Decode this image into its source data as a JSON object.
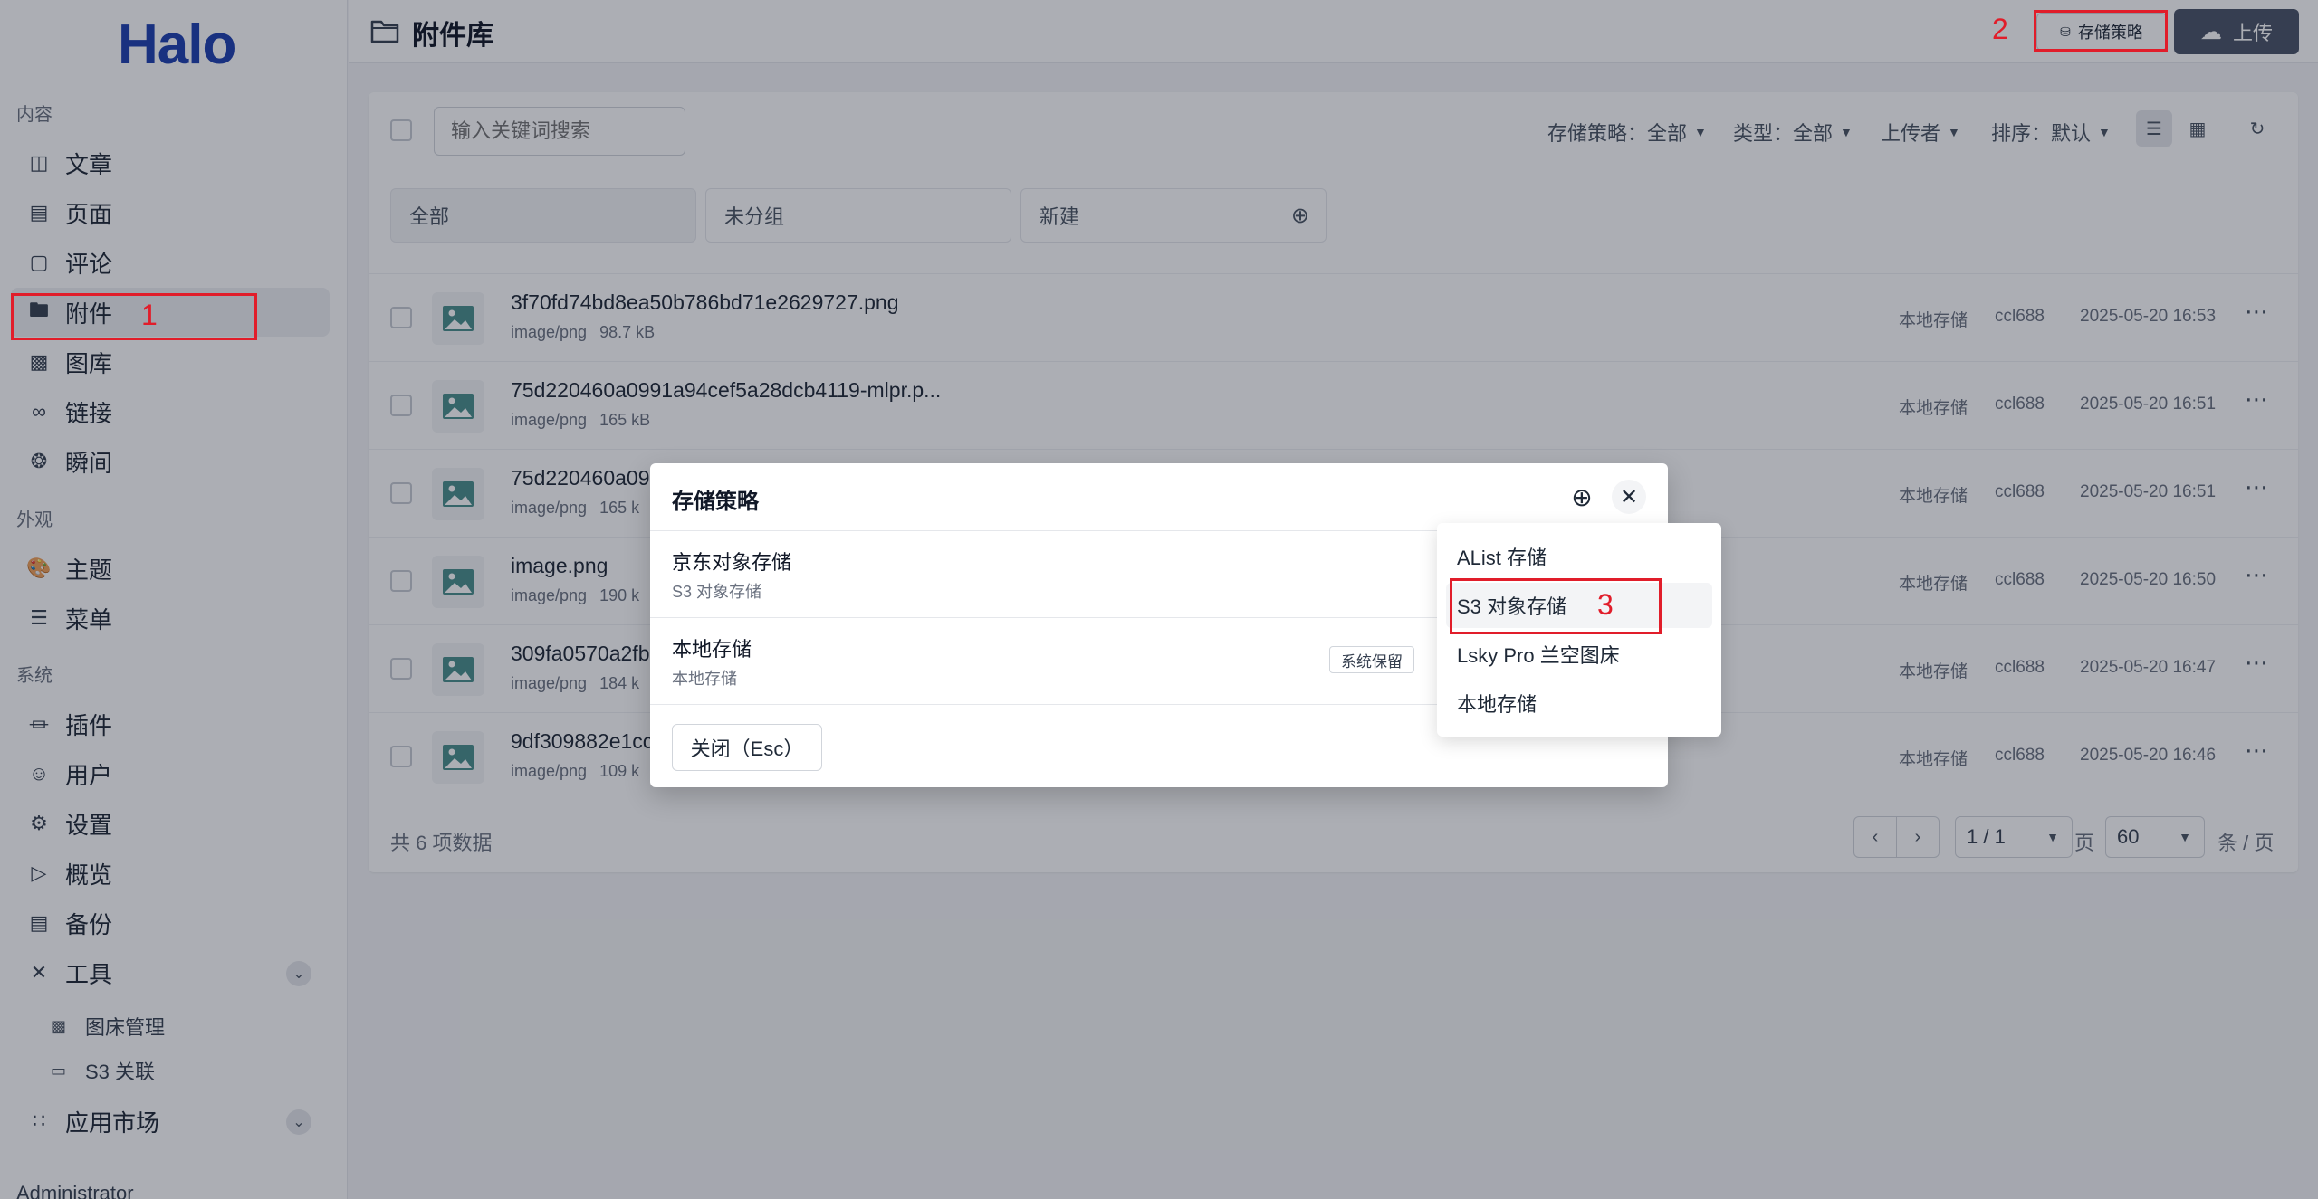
{
  "brand": {
    "logo": "Halo"
  },
  "sidebar": {
    "sections": {
      "content": "内容",
      "appearance": "外观",
      "system": "系统"
    },
    "items": [
      {
        "label": "文章",
        "icon": "book-open-icon"
      },
      {
        "label": "页面",
        "icon": "file-text-icon"
      },
      {
        "label": "评论",
        "icon": "message-icon"
      },
      {
        "label": "附件",
        "icon": "folder-icon"
      },
      {
        "label": "图库",
        "icon": "image-icon"
      },
      {
        "label": "链接",
        "icon": "link-icon"
      },
      {
        "label": "瞬间",
        "icon": "aperture-icon"
      },
      {
        "label": "主题",
        "icon": "palette-icon"
      },
      {
        "label": "菜单",
        "icon": "menu-settings-icon"
      },
      {
        "label": "插件",
        "icon": "plug-icon"
      },
      {
        "label": "用户",
        "icon": "user-icon"
      },
      {
        "label": "设置",
        "icon": "gear-icon"
      },
      {
        "label": "概览",
        "icon": "terminal-icon"
      },
      {
        "label": "备份",
        "icon": "archive-icon"
      },
      {
        "label": "工具",
        "icon": "tools-icon"
      },
      {
        "label": "应用市场",
        "icon": "grid-apps-icon"
      }
    ],
    "tool_subitems": [
      {
        "label": "图床管理",
        "icon": "image-manage-icon"
      },
      {
        "label": "S3 关联",
        "icon": "s3-link-icon"
      }
    ],
    "user": "Administrator"
  },
  "header": {
    "title": "附件库",
    "policies_button": "存储策略",
    "upload_button": "上传"
  },
  "toolbar": {
    "search_placeholder": "输入关键词搜索",
    "filter_policy": "存储策略：全部",
    "filter_type": "类型：全部",
    "filter_uploader": "上传者",
    "filter_sort": "排序：默认"
  },
  "groups": {
    "all": "全部",
    "ungrouped": "未分组",
    "new": "新建"
  },
  "files": [
    {
      "name": "3f70fd74bd8ea50b786bd71e2629727.png",
      "type": "image/png",
      "size": "98.7 kB",
      "policy": "本地存储",
      "user": "ccl688",
      "time": "2025-05-20 16:53"
    },
    {
      "name": "75d220460a0991a94cef5a28dcb4119-mlpr.p...",
      "type": "image/png",
      "size": "165 kB",
      "policy": "本地存储",
      "user": "ccl688",
      "time": "2025-05-20 16:51"
    },
    {
      "name": "75d220460a09",
      "type": "image/png",
      "size": "165 k",
      "policy": "本地存储",
      "user": "ccl688",
      "time": "2025-05-20 16:51"
    },
    {
      "name": "image.png",
      "type": "image/png",
      "size": "190 k",
      "policy": "本地存储",
      "user": "ccl688",
      "time": "2025-05-20 16:50"
    },
    {
      "name": "309fa0570a2fb",
      "type": "image/png",
      "size": "184 k",
      "policy": "本地存储",
      "user": "ccl688",
      "time": "2025-05-20 16:47"
    },
    {
      "name": "9df309882e1cc",
      "type": "image/png",
      "size": "109 k",
      "policy": "本地存储",
      "user": "ccl688",
      "time": "2025-05-20 16:46"
    }
  ],
  "footer": {
    "total": "共 6 项数据",
    "page_value": "1 / 1",
    "page_unit": "页",
    "size_value": "60",
    "size_unit": "条 / 页"
  },
  "modal": {
    "title": "存储策略",
    "policies": [
      {
        "name": "京东对象存储",
        "type": "S3 对象存储",
        "badge": ""
      },
      {
        "name": "本地存储",
        "type": "本地存储",
        "badge": "系统保留"
      }
    ],
    "close_button": "关闭（Esc）"
  },
  "dropdown": {
    "items": [
      "AList 存储",
      "S3 对象存储",
      "Lsky Pro 兰空图床",
      "本地存储"
    ]
  },
  "annotations": {
    "step1": "1",
    "step2": "2",
    "step3": "3"
  },
  "colors": {
    "accent": "#1e40af",
    "annotation": "#e11d2a",
    "primary_button": "#4a5467"
  }
}
